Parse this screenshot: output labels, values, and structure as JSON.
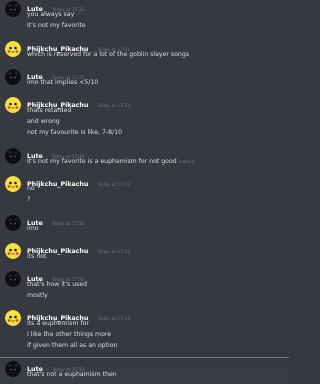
{
  "messages": [
    {
      "author": "Lute",
      "timestamp": "Today at 17:31",
      "lines": [
        "you always say",
        "it's not my favorite"
      ],
      "edited": ""
    },
    {
      "author": "Phijkchu_Pikachu",
      "timestamp": "Today at 17:31",
      "lines": [
        "which is reserved for a lot of the goblin slayer songs"
      ],
      "edited": ""
    },
    {
      "author": "Lute",
      "timestamp": "Today at 17:31",
      "lines": [
        "imo that implies <5/10"
      ],
      "edited": ""
    },
    {
      "author": "Phijkchu_Pikachu",
      "timestamp": "Today at 17:32",
      "lines": [
        "thats retarded",
        "and wrong",
        "not my favourite is like, 7-8/10"
      ],
      "edited": ""
    },
    {
      "author": "Lute",
      "timestamp": "Today at 17:32",
      "lines": [
        "it's not my favorite is a euphamism for not good"
      ],
      "edited": "(edited)"
    },
    {
      "author": "Phijkchu_Pikachu",
      "timestamp": "Today at 17:32",
      "lines": [
        "no",
        "?"
      ],
      "edited": ""
    },
    {
      "author": "Lute",
      "timestamp": "Today at 17:32",
      "lines": [
        "imo"
      ],
      "edited": ""
    },
    {
      "author": "Phijkchu_Pikachu",
      "timestamp": "Today at 17:32",
      "lines": [
        "its not"
      ],
      "edited": ""
    },
    {
      "author": "Lute",
      "timestamp": "Today at 17:32",
      "lines": [
        "that's how it's used",
        "mostly"
      ],
      "edited": ""
    },
    {
      "author": "Phijkchu_Pikachu",
      "timestamp": "Today at 17:32",
      "lines": [
        "its a euphemism for",
        "I like the other things more",
        "if given them all as an option"
      ],
      "edited": ""
    },
    {
      "author": "Lute",
      "timestamp": "Today at 17:32",
      "lines": [
        "that's not a euphamism then"
      ],
      "edited": ""
    }
  ],
  "colors": {
    "background": "#36393f",
    "username": "#ffffff",
    "timestamp": "#72767d",
    "text": "#dcddde",
    "new_divider": "#f04747",
    "pikachu_yellow": "#f6e23a"
  },
  "icons": {
    "lute_avatar": "black-cat-avatar-icon",
    "pikachu_avatar": "pikachu-avatar-icon"
  }
}
